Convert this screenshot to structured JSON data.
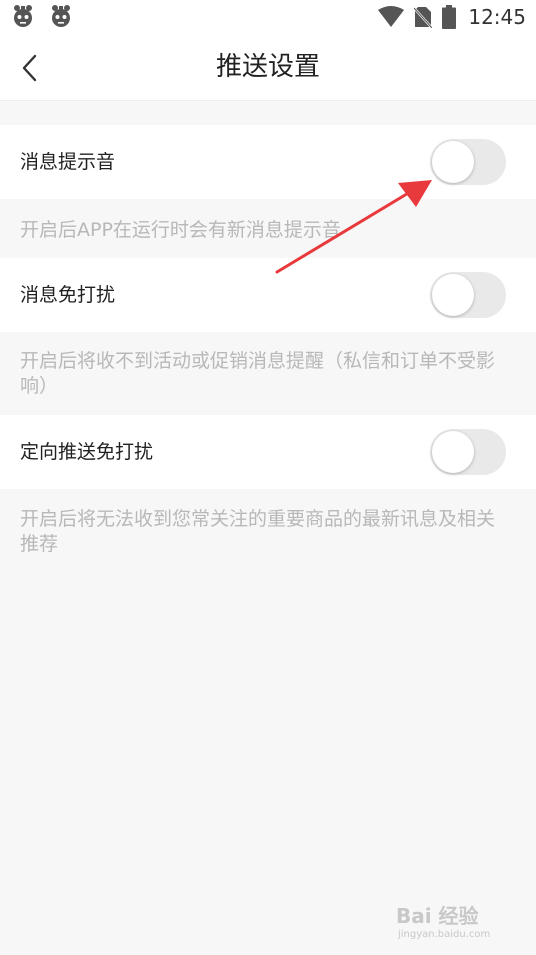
{
  "status_bar": {
    "time": "12:45"
  },
  "header": {
    "title": "推送设置"
  },
  "settings": [
    {
      "label": "消息提示音",
      "enabled": false,
      "description": "开启后APP在运行时会有新消息提示音"
    },
    {
      "label": "消息免打扰",
      "enabled": false,
      "description": "开启后将收不到活动或促销消息提醒（私信和订单不受影响）"
    },
    {
      "label": "定向推送免打扰",
      "enabled": false,
      "description": "开启后将无法收到您常关注的重要商品的最新讯息及相关推荐"
    }
  ],
  "watermark": {
    "text": "Bai 经验",
    "subtext": "jingyan.baidu.com"
  },
  "colors": {
    "annotation_arrow": "#e8393c",
    "toggle_off": "#e9e9e9",
    "description_text": "#b8b8b8"
  }
}
